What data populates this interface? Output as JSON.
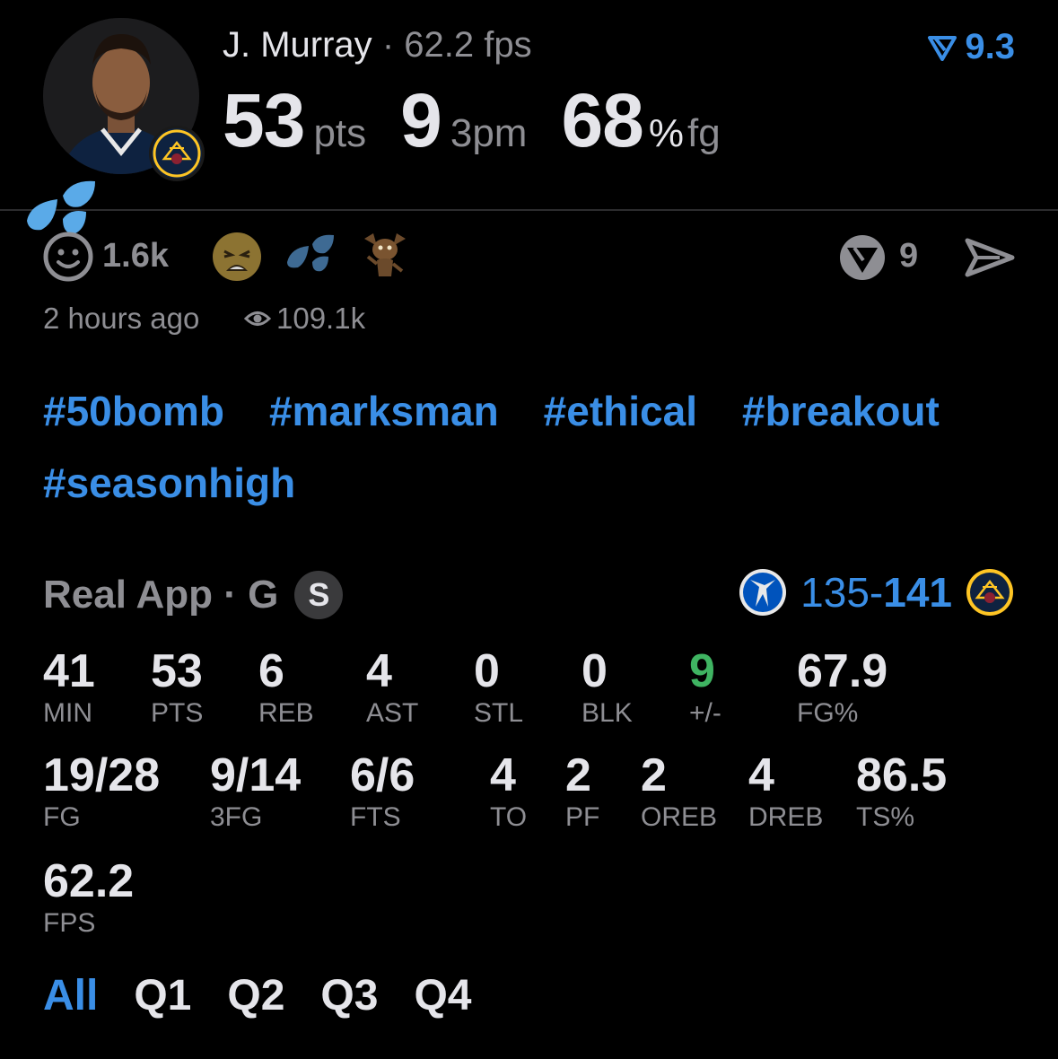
{
  "player": {
    "name": "J. Murray",
    "separator": "·",
    "fps_text": "62.2 fps",
    "rating": "9.3",
    "headline": {
      "pts_value": "53",
      "pts_unit": "pts",
      "threes_value": "9",
      "threes_unit": "3pm",
      "fg_value": "68",
      "fg_pct_sign": "%",
      "fg_unit": "fg"
    }
  },
  "reactions": {
    "count": "1.6k",
    "share_count": "9",
    "time_ago": "2 hours ago",
    "views": "109.1k"
  },
  "tags": [
    "#50bomb",
    "#marksman",
    "#ethical",
    "#breakout",
    "#seasonhigh"
  ],
  "game": {
    "label": "Real App · G",
    "badge": "S",
    "score_away": "135",
    "score_dash": "-",
    "score_home": "141"
  },
  "stats_row1": [
    {
      "value": "41",
      "label": "MIN"
    },
    {
      "value": "53",
      "label": "PTS"
    },
    {
      "value": "6",
      "label": "REB"
    },
    {
      "value": "4",
      "label": "AST"
    },
    {
      "value": "0",
      "label": "STL"
    },
    {
      "value": "0",
      "label": "BLK"
    },
    {
      "value": "9",
      "label": "+/-"
    },
    {
      "value": "67.9",
      "label": "FG%"
    }
  ],
  "stats_row2": [
    {
      "value": "19/28",
      "label": "FG"
    },
    {
      "value": "9/14",
      "label": "3FG"
    },
    {
      "value": "6/6",
      "label": "FTS"
    },
    {
      "value": "4",
      "label": "TO"
    },
    {
      "value": "2",
      "label": "PF"
    },
    {
      "value": "2",
      "label": "OREB"
    },
    {
      "value": "4",
      "label": "DREB"
    },
    {
      "value": "86.5",
      "label": "TS%"
    }
  ],
  "stats_row3": [
    {
      "value": "62.2",
      "label": "FPS"
    }
  ],
  "tabs": [
    "All",
    "Q1",
    "Q2",
    "Q3",
    "Q4"
  ],
  "colors": {
    "accent": "#3a8ee6",
    "positive": "#3fb462",
    "muted": "#8e8e93",
    "background": "#000000"
  }
}
